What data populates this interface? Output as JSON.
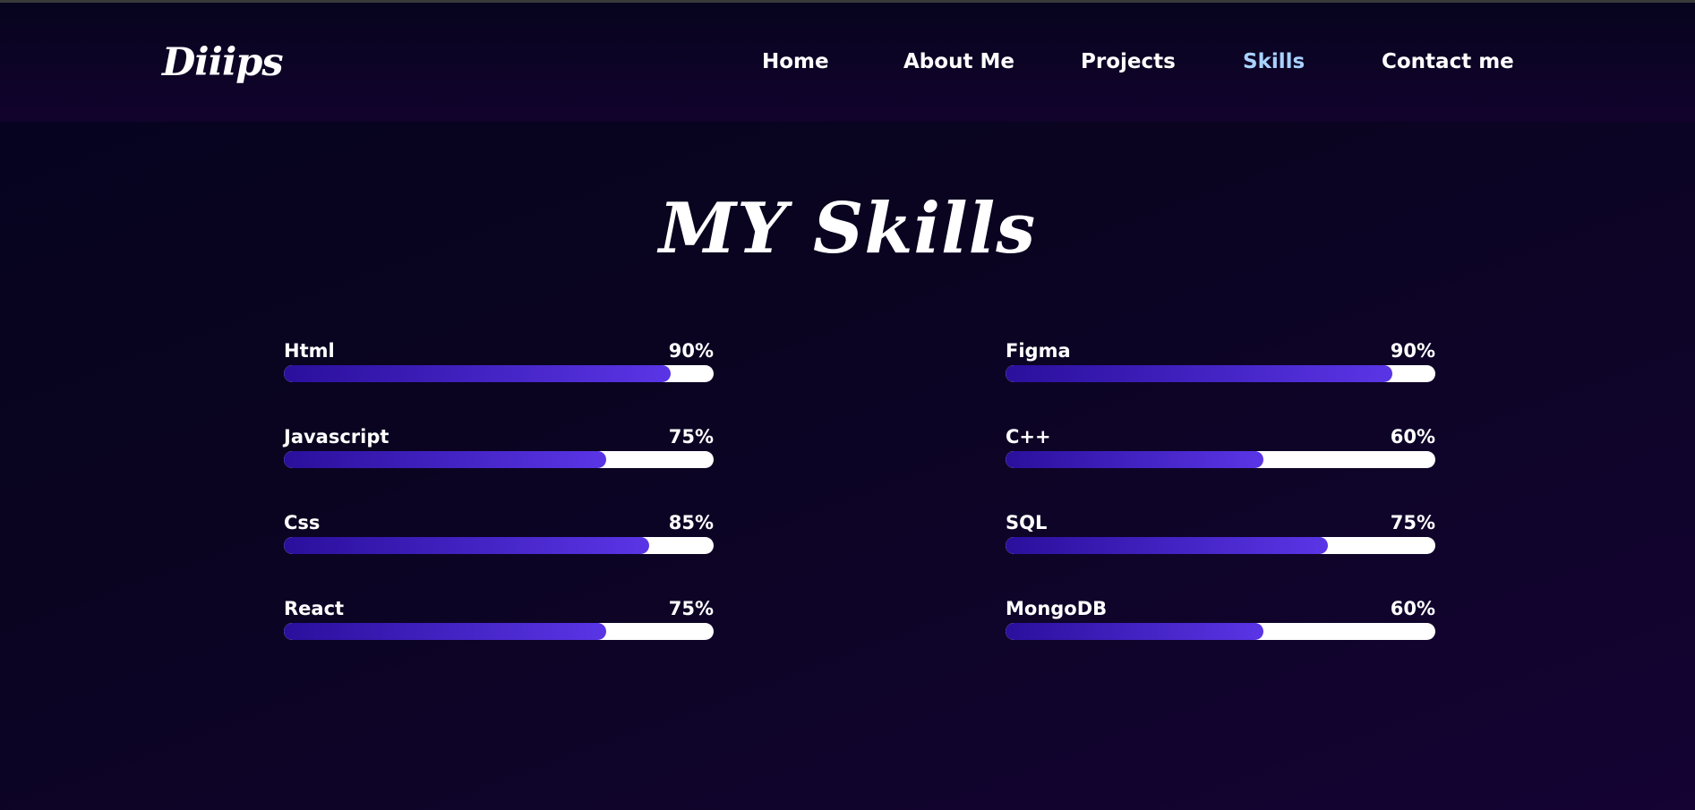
{
  "brand": {
    "logo": "Diiips"
  },
  "nav": [
    {
      "label": "Home",
      "active": false
    },
    {
      "label": "About Me",
      "active": false
    },
    {
      "label": "Projects",
      "active": false
    },
    {
      "label": "Skills",
      "active": true
    },
    {
      "label": "Contact me",
      "active": false
    }
  ],
  "section": {
    "title": "MY Skills"
  },
  "skills": {
    "left": [
      {
        "name": "Html",
        "percent_label": "90%",
        "percent": 90
      },
      {
        "name": "Javascript",
        "percent_label": "75%",
        "percent": 75
      },
      {
        "name": "Css",
        "percent_label": "85%",
        "percent": 85
      },
      {
        "name": "React",
        "percent_label": "75%",
        "percent": 75
      }
    ],
    "right": [
      {
        "name": "Figma",
        "percent_label": "90%",
        "percent": 90
      },
      {
        "name": "C++",
        "percent_label": "60%",
        "percent": 60
      },
      {
        "name": "SQL",
        "percent_label": "75%",
        "percent": 75
      },
      {
        "name": "MongoDB",
        "percent_label": "60%",
        "percent": 60
      }
    ]
  },
  "colors": {
    "active_nav": "#a9d2ff",
    "bar_start": "#2a0f9c",
    "bar_end": "#5a35e6",
    "track": "#ffffff"
  }
}
